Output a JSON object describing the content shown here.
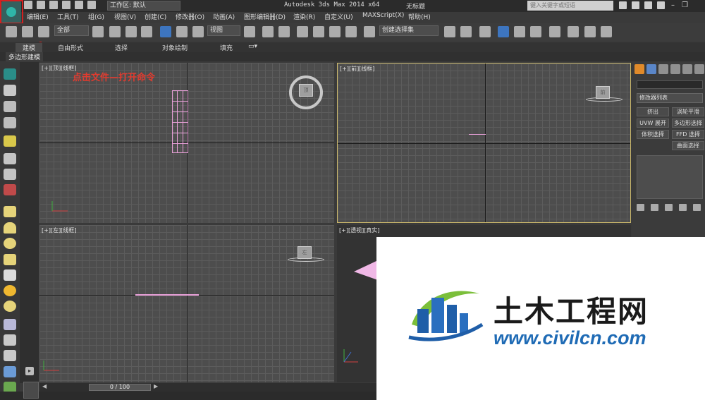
{
  "title_bar": {
    "workspace_label": "工作区: 默认",
    "app_title": "Autodesk 3ds Max  2014 x64",
    "doc_title": "无标题",
    "search_placeholder": "键入关键字或短语"
  },
  "menu": {
    "items": [
      "编辑(E)",
      "工具(T)",
      "组(G)",
      "视图(V)",
      "创建(C)",
      "修改器(O)",
      "动画(A)",
      "图形编辑器(D)",
      "渲染(R)",
      "自定义(U)",
      "MAXScript(X)",
      "帮助(H)"
    ]
  },
  "toolbar": {
    "selection_filter": "全部",
    "ref_coord": "视图",
    "named_selection": "创建选择集"
  },
  "ribbon": {
    "tabs": [
      "建模",
      "自由形式",
      "选择",
      "对象绘制",
      "填充"
    ],
    "active_tab": "建模",
    "sub_label": "多边形建模"
  },
  "annotation_text": "点击文件—打开命令",
  "viewports": {
    "top": {
      "label": "[+][顶][线框]",
      "cube": "顶"
    },
    "front": {
      "label": "[+][前][线框]",
      "cube": "前"
    },
    "left": {
      "label": "[+][左][线框]",
      "cube": "左"
    },
    "perspective": {
      "label": "[+][透视][真实]"
    }
  },
  "command_panel": {
    "modifier_list": "修改器列表",
    "buttons": [
      "挤出",
      "涡轮平滑",
      "UVW 展开",
      "多边形选择",
      "体积选择",
      "FFD 选择",
      "曲面选择"
    ]
  },
  "timeline": {
    "frame": "0 / 100"
  },
  "watermark": {
    "name_cn": "土木工程网",
    "url": "www.civilcn.com"
  },
  "colors": {
    "annotation": "#e23b2f",
    "highlight_box": "#d42020",
    "watermark_url": "#1f6bb5"
  }
}
